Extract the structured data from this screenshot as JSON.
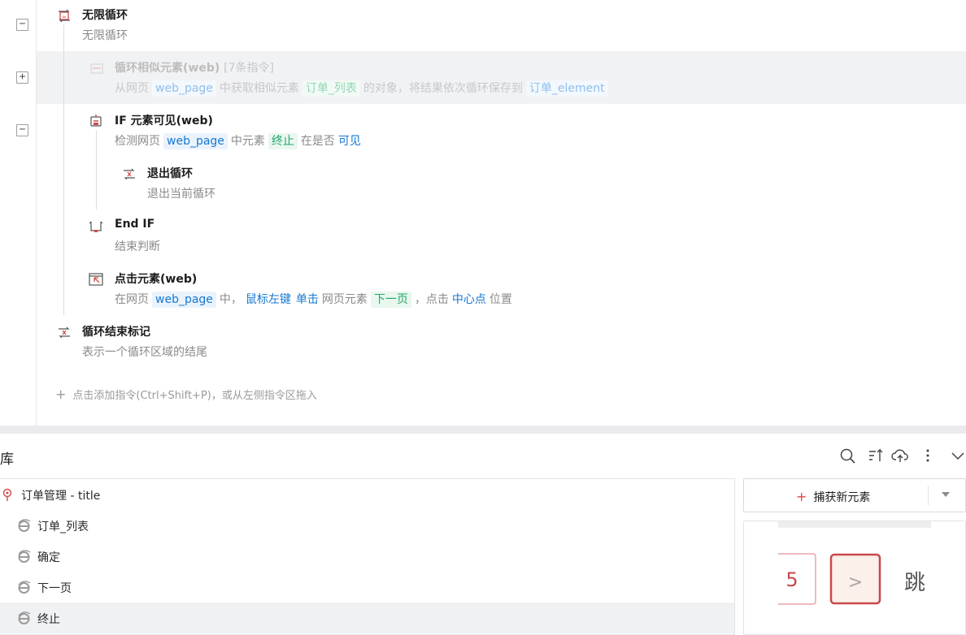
{
  "flow": {
    "commands": [
      {
        "title": "无限循环",
        "desc": "无限循环",
        "toggle": "−"
      },
      {
        "title": "循环相似元素(web)",
        "count": "[7条指令]",
        "toggle": "+",
        "desc_parts": {
          "a": "从网页",
          "b": "web_page",
          "c": "中获取相似元素",
          "d": "订单_列表",
          "e": "的对象，将结果依次循环保存到",
          "f": "订单_element"
        }
      },
      {
        "title": "IF 元素可见(web)",
        "toggle": "−",
        "desc_parts": {
          "a": "检测网页",
          "b": "web_page",
          "c": "中元素",
          "d": "终止",
          "e": "在是否",
          "f": "可见"
        }
      },
      {
        "title": "退出循环",
        "desc": "退出当前循环"
      },
      {
        "title": "End IF",
        "desc": "结束判断"
      },
      {
        "title": "点击元素(web)",
        "desc_parts": {
          "a": "在网页",
          "b": "web_page",
          "c": "中，",
          "d": "鼠标左键",
          "e": "单击",
          "f": "网页元素",
          "g": "下一页",
          "h": "，点击",
          "i": "中心点",
          "j": "位置"
        }
      },
      {
        "title": "循环结束标记",
        "desc": "表示一个循环区域的结尾"
      }
    ],
    "add_hint": "点击添加指令(Ctrl+Shift+P)，或从左侧指令区拖入"
  },
  "library": {
    "title": "库",
    "items": [
      {
        "label": "订单管理 - title",
        "icon": "pin-icon"
      },
      {
        "label": "订单_列表",
        "icon": "ie-browser-icon"
      },
      {
        "label": "确定",
        "icon": "ie-browser-icon"
      },
      {
        "label": "下一页",
        "icon": "ie-browser-icon"
      },
      {
        "label": "终止",
        "icon": "ie-browser-icon",
        "selected": true
      }
    ],
    "capture_button": "捕获新元素",
    "preview": {
      "page_number": "5",
      "next_symbol": ">",
      "jump_text": "跳"
    }
  },
  "colors": {
    "link_blue": "#1678d2",
    "tag_green": "#23a66b",
    "accent_red": "#e04545"
  }
}
